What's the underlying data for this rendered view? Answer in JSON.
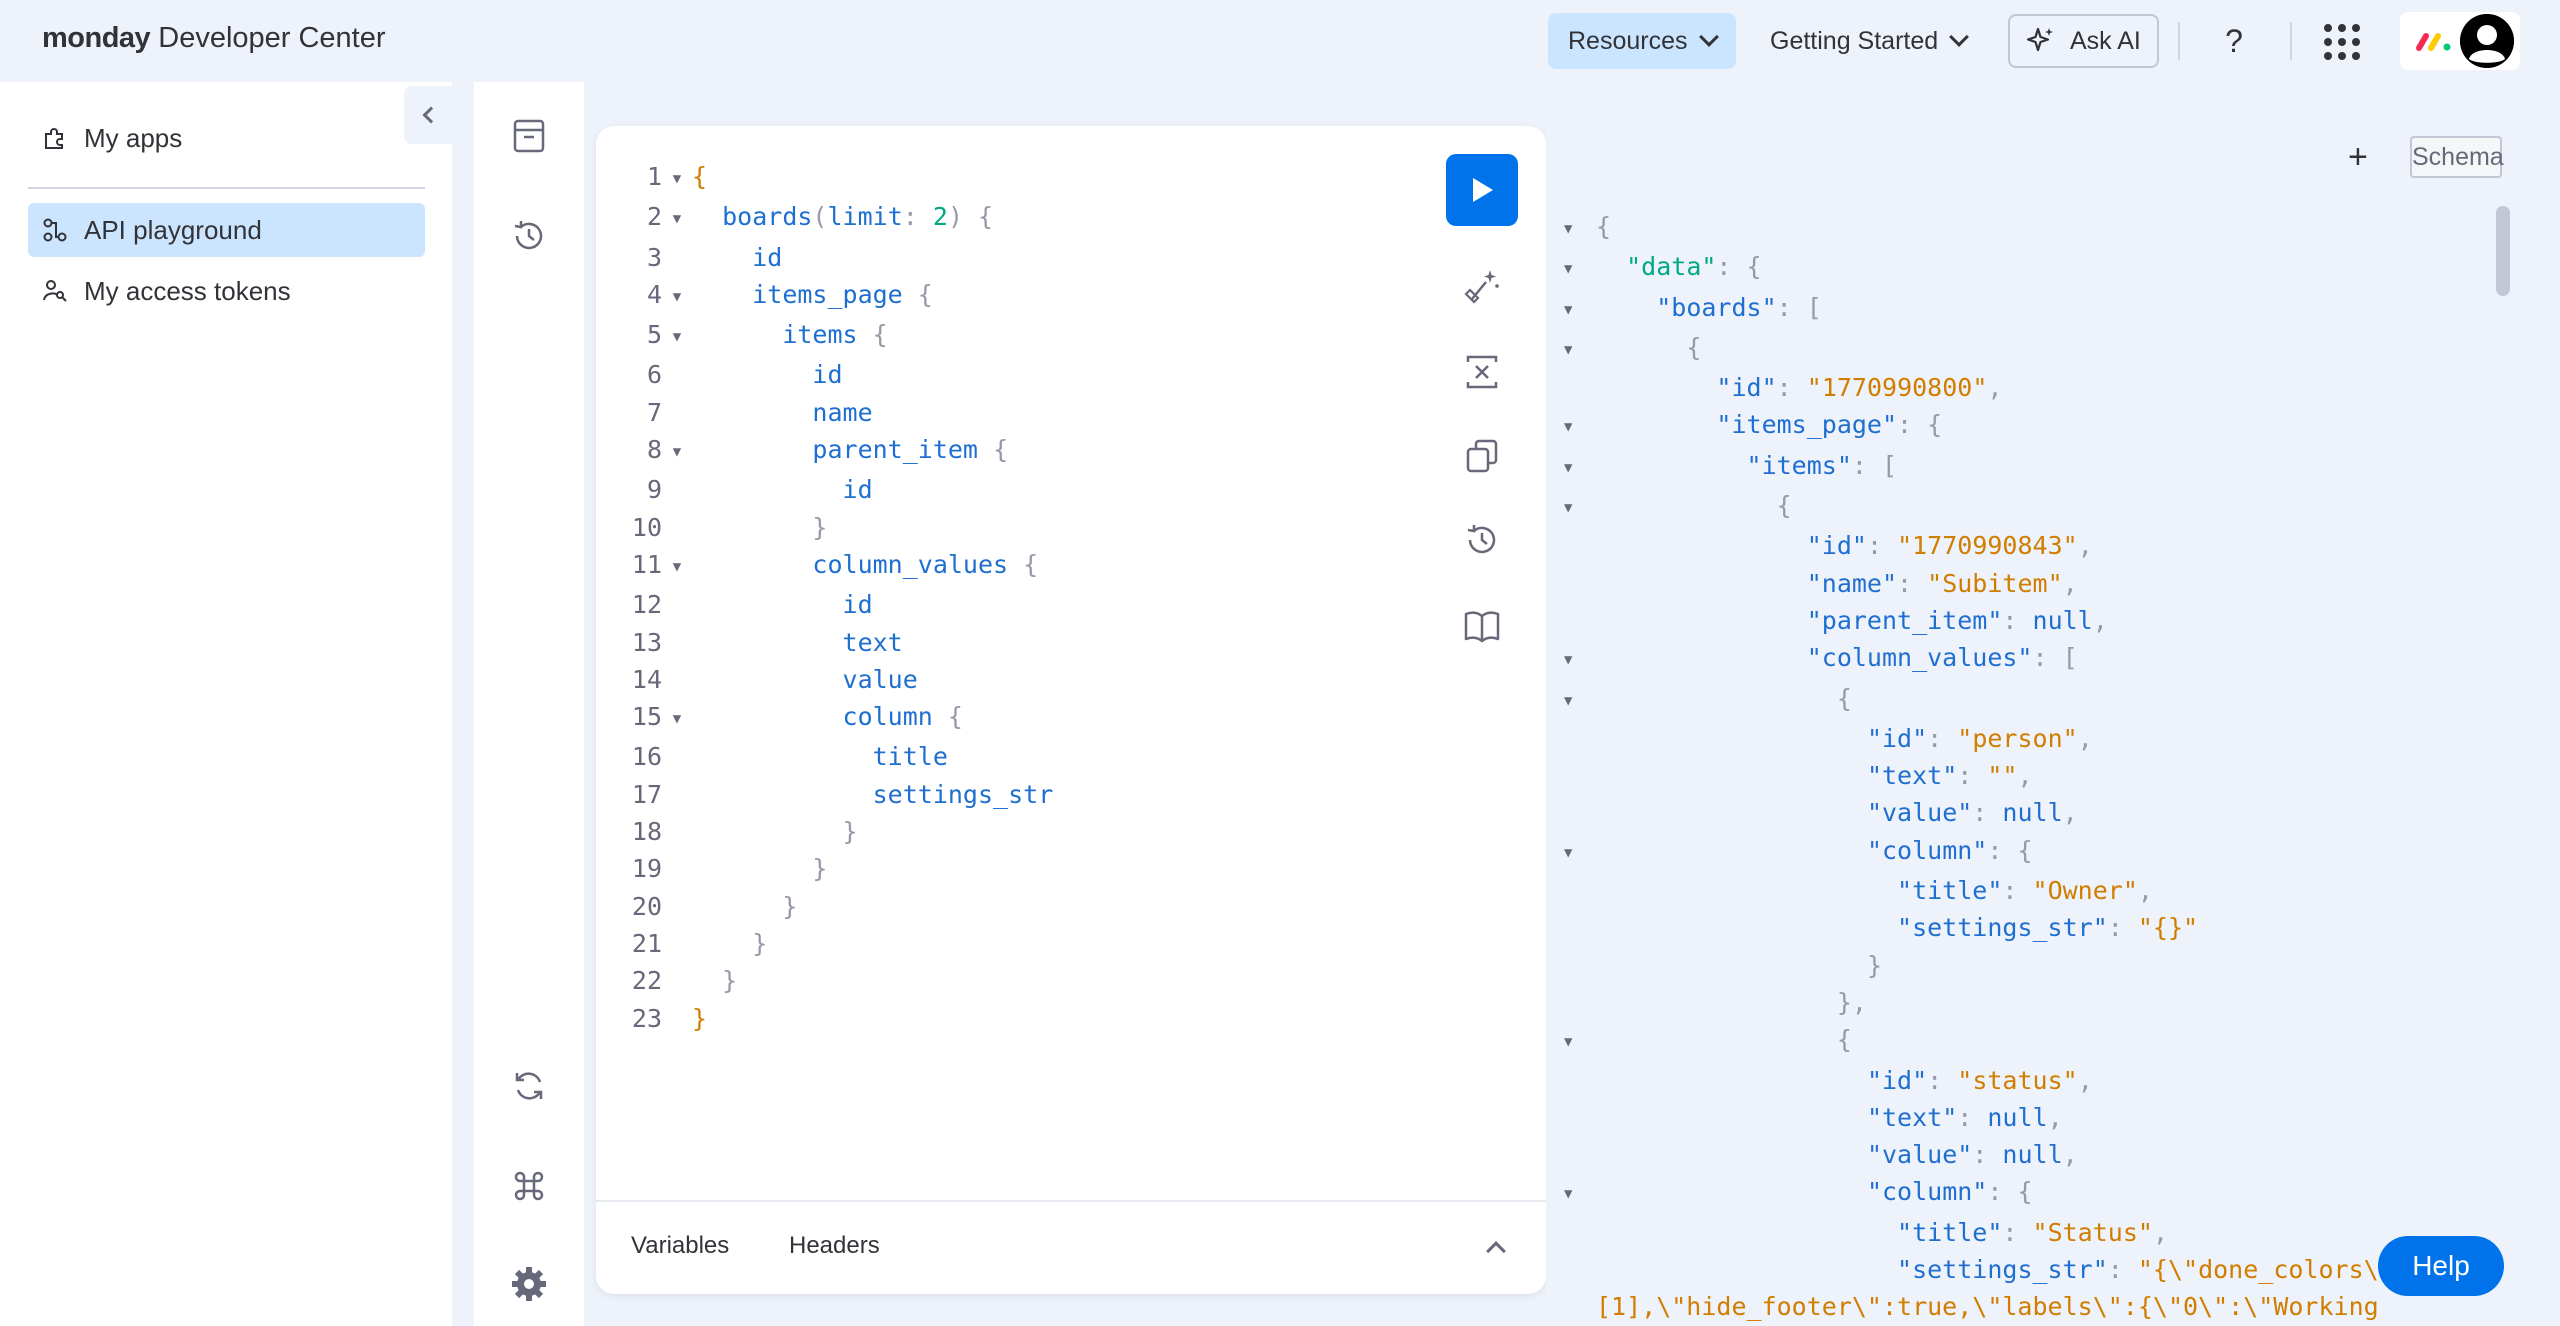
{
  "header": {
    "brand_bold": "monday",
    "brand_rest": " Developer Center",
    "resources_label": "Resources",
    "getting_started_label": "Getting Started",
    "ask_ai_label": "Ask AI",
    "help_label": "?"
  },
  "sidebar": {
    "items": [
      {
        "label": "My apps",
        "icon": "puzzle-icon"
      },
      {
        "label": "API playground",
        "icon": "api-icon",
        "active": true
      },
      {
        "label": "My access tokens",
        "icon": "key-user-icon"
      }
    ]
  },
  "editor": {
    "run_label": "Run query",
    "tabs": {
      "variables": "Variables",
      "headers": "Headers"
    }
  },
  "results": {
    "plus_label": "+",
    "schema_label": "Schema"
  },
  "help_fab": "Help",
  "colors": {
    "accent": "#0073ea",
    "active_bg": "#cce5ff",
    "code_field": "#1f6fd1",
    "code_number": "#00a884",
    "code_string": "#d17d00"
  }
}
